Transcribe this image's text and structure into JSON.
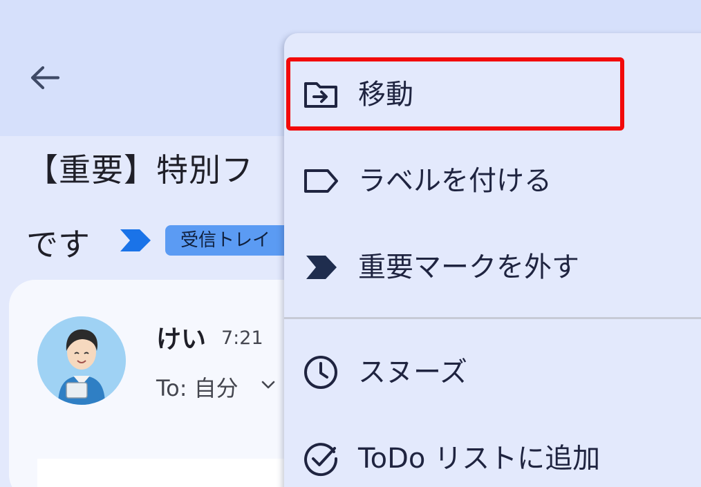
{
  "email": {
    "subject_line1": "【重要】特別フ",
    "subject_line2": "です",
    "inbox_chip": "受信トレイ",
    "sender_name": "けい",
    "time": "7:21",
    "recipient": "To: 自分"
  },
  "menu": {
    "items": [
      {
        "label": "移動",
        "icon": "folder-move-icon"
      },
      {
        "label": "ラベルを付ける",
        "icon": "label-icon"
      },
      {
        "label": "重要マークを外す",
        "icon": "important-icon"
      },
      {
        "label": "スヌーズ",
        "icon": "clock-icon"
      },
      {
        "label": "ToDo リストに追加",
        "icon": "task-add-icon"
      }
    ]
  },
  "colors": {
    "highlight": "#f20a0a",
    "chip": "#5b9bf3",
    "important_marker": "#1a73e8",
    "icon": "#1f2440"
  }
}
